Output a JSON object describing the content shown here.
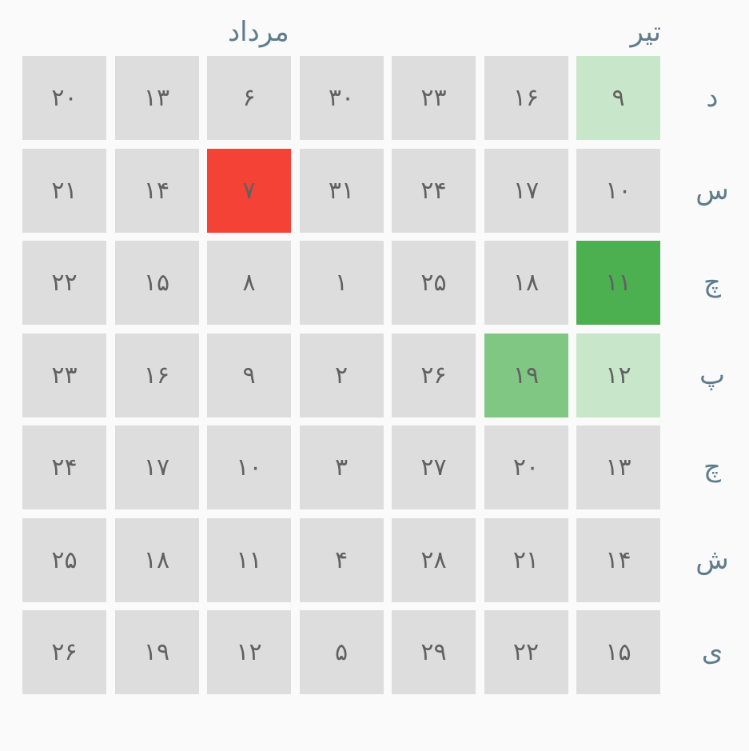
{
  "months": {
    "tir": "تیر",
    "mordad": "مرداد"
  },
  "weekdays": [
    "د",
    "س",
    "چ",
    "پ",
    "چ",
    "ش",
    "ی"
  ],
  "colors": {
    "empty": "#dddddd",
    "level1": "#c8e6c9",
    "level2": "#81c784",
    "level3": "#4caf50",
    "today": "#f44336",
    "text": "#616161",
    "label": "#5f7d8c"
  },
  "rows": [
    [
      {
        "day": "۲۰",
        "level": 0
      },
      {
        "day": "۱۳",
        "level": 0
      },
      {
        "day": "۶",
        "level": 0
      },
      {
        "day": "۳۰",
        "level": 0
      },
      {
        "day": "۲۳",
        "level": 0
      },
      {
        "day": "۱۶",
        "level": 0
      },
      {
        "day": "۹",
        "level": 1
      }
    ],
    [
      {
        "day": "۲۱",
        "level": 0
      },
      {
        "day": "۱۴",
        "level": 0
      },
      {
        "day": "۷",
        "level": "today"
      },
      {
        "day": "۳۱",
        "level": 0
      },
      {
        "day": "۲۴",
        "level": 0
      },
      {
        "day": "۱۷",
        "level": 0
      },
      {
        "day": "۱۰",
        "level": 0
      }
    ],
    [
      {
        "day": "۲۲",
        "level": 0
      },
      {
        "day": "۱۵",
        "level": 0
      },
      {
        "day": "۸",
        "level": 0
      },
      {
        "day": "۱",
        "level": 0
      },
      {
        "day": "۲۵",
        "level": 0
      },
      {
        "day": "۱۸",
        "level": 0
      },
      {
        "day": "۱۱",
        "level": 3
      }
    ],
    [
      {
        "day": "۲۳",
        "level": 0
      },
      {
        "day": "۱۶",
        "level": 0
      },
      {
        "day": "۹",
        "level": 0
      },
      {
        "day": "۲",
        "level": 0
      },
      {
        "day": "۲۶",
        "level": 0
      },
      {
        "day": "۱۹",
        "level": 2
      },
      {
        "day": "۱۲",
        "level": 1
      }
    ],
    [
      {
        "day": "۲۴",
        "level": 0
      },
      {
        "day": "۱۷",
        "level": 0
      },
      {
        "day": "۱۰",
        "level": 0
      },
      {
        "day": "۳",
        "level": 0
      },
      {
        "day": "۲۷",
        "level": 0
      },
      {
        "day": "۲۰",
        "level": 0
      },
      {
        "day": "۱۳",
        "level": 0
      }
    ],
    [
      {
        "day": "۲۵",
        "level": 0
      },
      {
        "day": "۱۸",
        "level": 0
      },
      {
        "day": "۱۱",
        "level": 0
      },
      {
        "day": "۴",
        "level": 0
      },
      {
        "day": "۲۸",
        "level": 0
      },
      {
        "day": "۲۱",
        "level": 0
      },
      {
        "day": "۱۴",
        "level": 0
      }
    ],
    [
      {
        "day": "۲۶",
        "level": 0
      },
      {
        "day": "۱۹",
        "level": 0
      },
      {
        "day": "۱۲",
        "level": 0
      },
      {
        "day": "۵",
        "level": 0
      },
      {
        "day": "۲۹",
        "level": 0
      },
      {
        "day": "۲۲",
        "level": 0
      },
      {
        "day": "۱۵",
        "level": 0
      }
    ]
  ]
}
